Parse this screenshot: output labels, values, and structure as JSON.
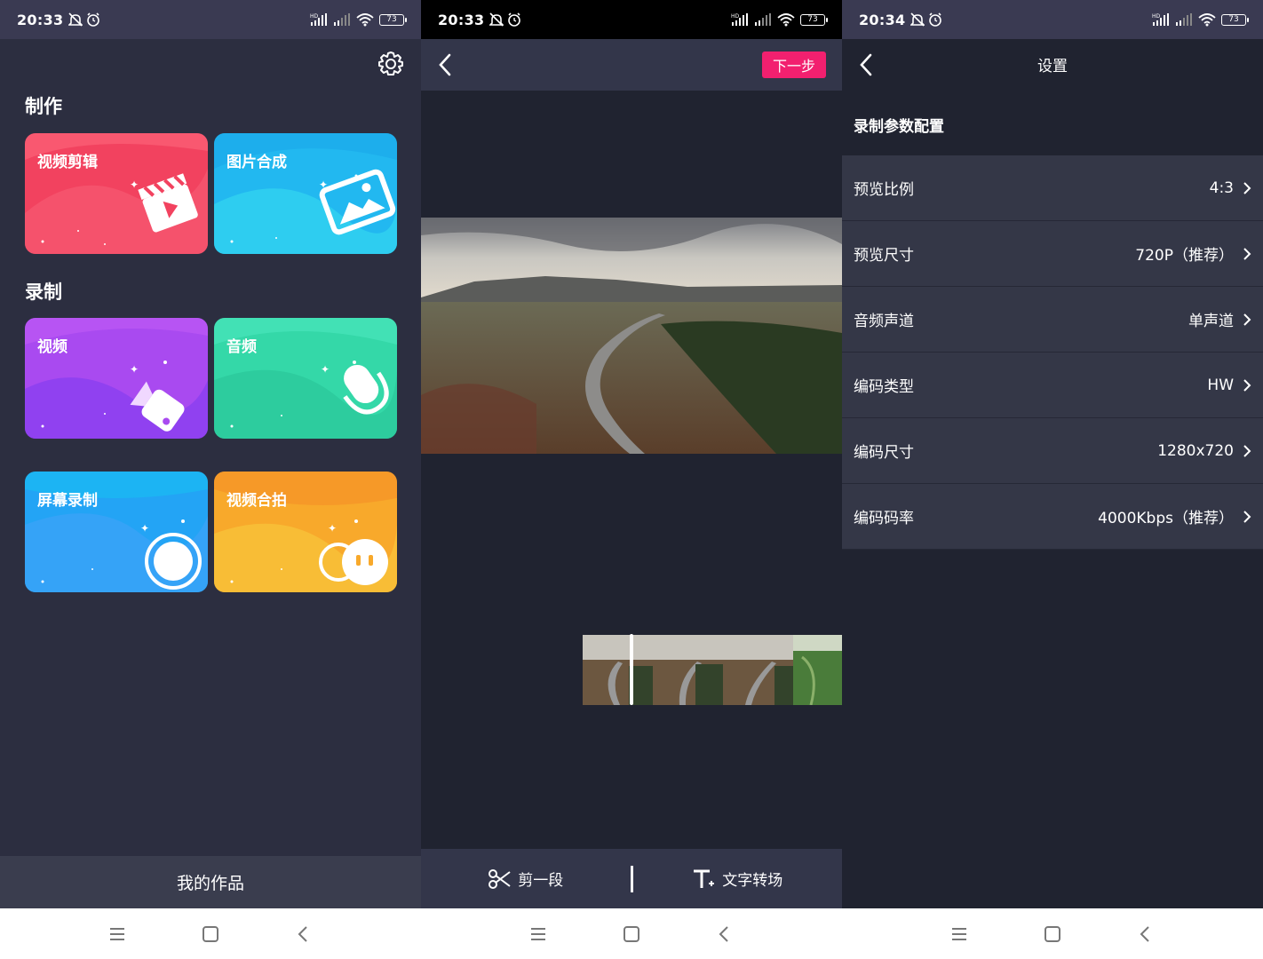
{
  "screen1": {
    "status": {
      "time": "20:33",
      "battery": "73"
    },
    "section_make": "制作",
    "section_record": "录制",
    "cards": [
      {
        "label": "视频剪辑",
        "icon": "clapperboard-icon",
        "color": "#f2425f"
      },
      {
        "label": "图片合成",
        "icon": "image-icon",
        "color": "#22b8f0"
      },
      {
        "label": "视频",
        "icon": "video-camera-icon",
        "color": "#a94af0"
      },
      {
        "label": "音频",
        "icon": "microphone-icon",
        "color": "#34d8a8"
      },
      {
        "label": "屏幕录制",
        "icon": "record-circle-icon",
        "color": "#23a4f5"
      },
      {
        "label": "视频合拍",
        "icon": "duet-icon",
        "color": "#f8a92b"
      }
    ],
    "bottom_tab": "我的作品"
  },
  "screen2": {
    "status": {
      "time": "20:33",
      "battery": "73"
    },
    "next_label": "下一步",
    "tools": [
      {
        "label": "剪一段",
        "icon": "scissors-icon"
      },
      {
        "label": "文字转场",
        "icon": "text-icon"
      }
    ]
  },
  "screen3": {
    "status": {
      "time": "20:34",
      "battery": "73"
    },
    "title": "设置",
    "section": "录制参数配置",
    "rows": [
      {
        "label": "预览比例",
        "value": "4:3"
      },
      {
        "label": "预览尺寸",
        "value": "720P（推荐）"
      },
      {
        "label": "音频声道",
        "value": "单声道"
      },
      {
        "label": "编码类型",
        "value": "HW"
      },
      {
        "label": "编码尺寸",
        "value": "1280x720"
      },
      {
        "label": "编码码率",
        "value": "4000Kbps（推荐）"
      }
    ]
  },
  "colors": {
    "accent": "#f2206f",
    "panel": "#33364a",
    "bg": "#202330"
  }
}
